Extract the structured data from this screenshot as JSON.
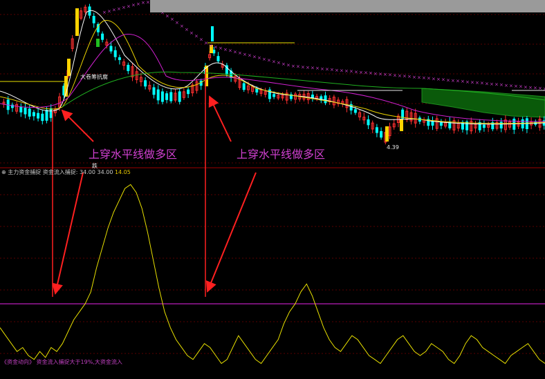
{
  "chart_data": [
    {
      "type": "candlestick",
      "panel": "price",
      "title": "",
      "labels": {
        "low_mark": "4.39",
        "top_label": "大卷筹抗腐"
      }
    },
    {
      "type": "line",
      "panel": "indicator",
      "title": "主力资金捕捉",
      "subtitle": "资金流入捕捉",
      "values_text": [
        "34.00",
        "34.00",
        "14.05"
      ],
      "level_line": 34,
      "series": [
        {
          "name": "资金流入捕捉",
          "color": "#e8e000",
          "values": [
            22,
            18,
            14,
            10,
            12,
            8,
            6,
            10,
            7,
            12,
            10,
            14,
            20,
            26,
            30,
            34,
            40,
            52,
            62,
            72,
            80,
            86,
            92,
            94,
            90,
            82,
            70,
            56,
            42,
            30,
            22,
            16,
            12,
            8,
            6,
            10,
            14,
            12,
            8,
            4,
            6,
            12,
            18,
            14,
            10,
            6,
            4,
            8,
            12,
            16,
            24,
            30,
            34,
            40,
            44,
            38,
            30,
            22,
            16,
            12,
            10,
            14,
            18,
            16,
            12,
            8,
            6,
            4,
            8,
            12,
            16,
            18,
            14,
            10,
            8,
            10,
            14,
            12,
            10,
            6,
            4,
            8,
            14,
            18,
            16,
            12,
            10,
            8,
            6,
            4,
            8,
            10,
            12,
            14,
            10,
            6,
            4
          ]
        }
      ]
    }
  ],
  "annotations": {
    "left": "上穿水平线做多区",
    "right": "上穿水平线做多区"
  },
  "misc": {
    "small_mark": "跌",
    "footer1": "《资金动向》",
    "footer2": "资金流入捕捉大于19%,大资金流入"
  },
  "colors": {
    "bull": "#ff3030",
    "bear": "#00ffff",
    "signal": "#ffd200",
    "ma5": "#ffffff",
    "ma10": "#e8d000",
    "ma20": "#d020d0",
    "ma60": "#20b020",
    "cloud": "#0a5a0a",
    "dots": "#d040d0",
    "arrow": "#ff2020",
    "level": "#d020d0"
  }
}
